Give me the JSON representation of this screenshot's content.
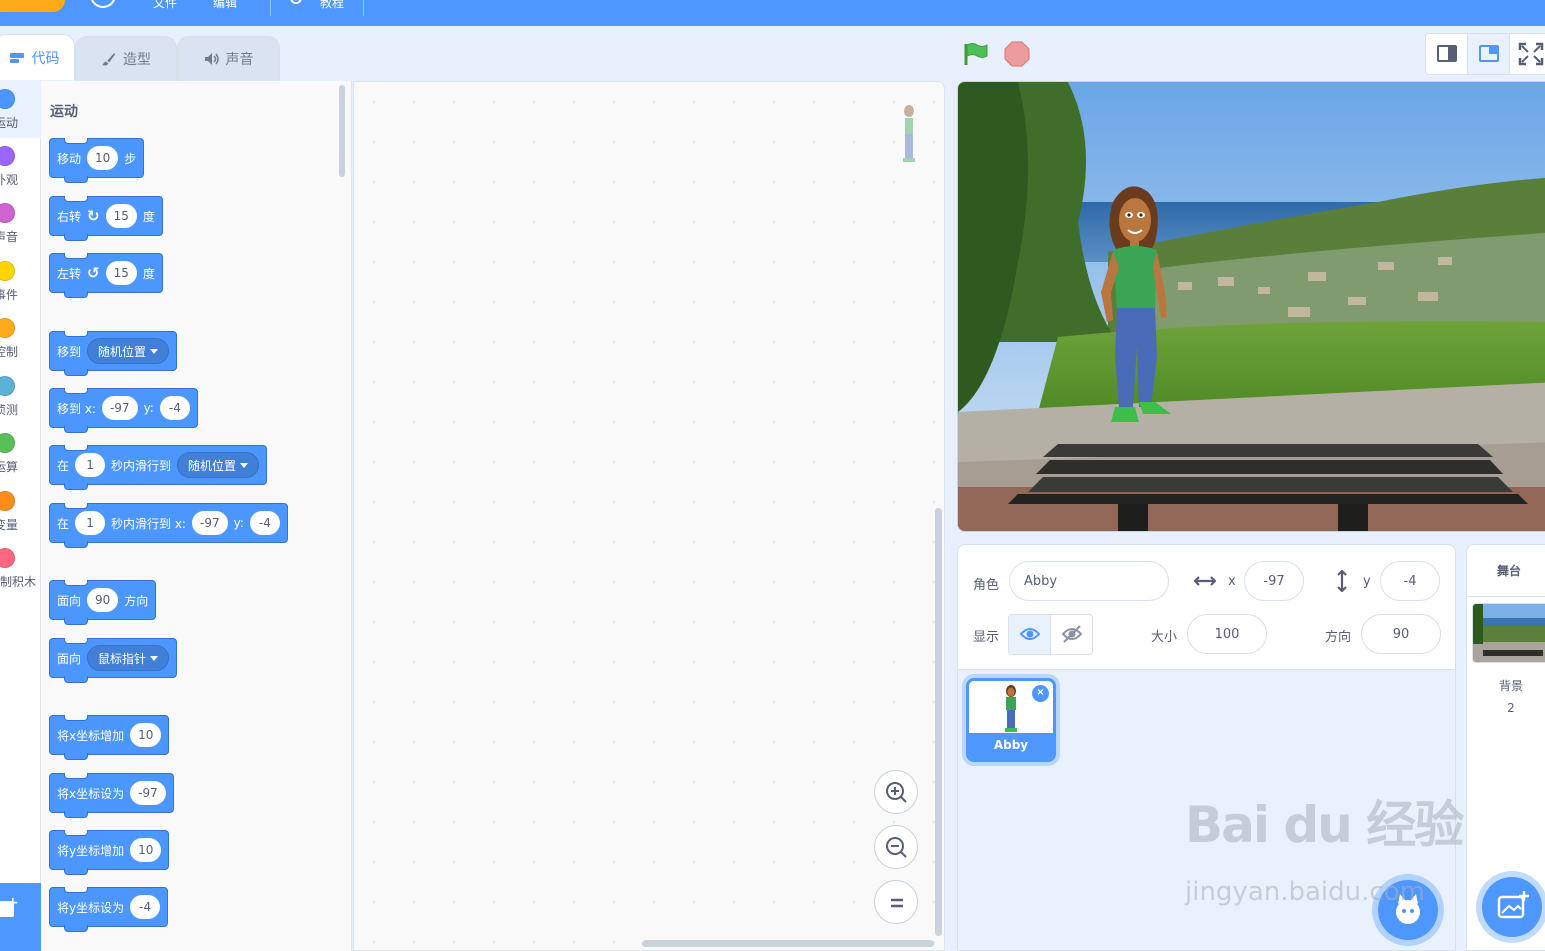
{
  "menubar": {
    "items": [
      "文件",
      "编辑",
      "教程"
    ],
    "accent": "#4d97ff"
  },
  "tabs": [
    {
      "label": "代码",
      "icon": "code-icon",
      "active": true
    },
    {
      "label": "造型",
      "icon": "brush-icon",
      "active": false
    },
    {
      "label": "声音",
      "icon": "speaker-icon",
      "active": false
    }
  ],
  "categories": [
    {
      "label": "运动",
      "color": "#4c97ff",
      "selected": true
    },
    {
      "label": "外观",
      "color": "#9966ff"
    },
    {
      "label": "声音",
      "color": "#cf63cf"
    },
    {
      "label": "事件",
      "color": "#ffd500"
    },
    {
      "label": "控制",
      "color": "#ffab19"
    },
    {
      "label": "侦测",
      "color": "#5cb1d6"
    },
    {
      "label": "运算",
      "color": "#59c059"
    },
    {
      "label": "变量",
      "color": "#ff8c1a"
    },
    {
      "label": "自制积木",
      "color": "#ff6680"
    }
  ],
  "palette": {
    "title": "运动",
    "blocks": {
      "move": {
        "t1": "移动",
        "v1": "10",
        "t2": "步"
      },
      "turn_right": {
        "t1": "右转",
        "icon": "rotate-clockwise-icon",
        "v1": "15",
        "t2": "度"
      },
      "turn_left": {
        "t1": "左转",
        "icon": "rotate-counterclockwise-icon",
        "v1": "15",
        "t2": "度"
      },
      "goto": {
        "t1": "移到",
        "dd": "随机位置"
      },
      "goto_xy": {
        "t1": "移到 x:",
        "x": "-97",
        "t2": "y:",
        "y": "-4"
      },
      "glide_to": {
        "t1": "在",
        "v1": "1",
        "t2": "秒内滑行到",
        "dd": "随机位置"
      },
      "glide_xy": {
        "t1": "在",
        "v1": "1",
        "t2": "秒内滑行到 x:",
        "x": "-97",
        "t3": "y:",
        "y": "-4"
      },
      "point_dir": {
        "t1": "面向",
        "v1": "90",
        "t2": "方向"
      },
      "point_towards": {
        "t1": "面向",
        "dd": "鼠标指针"
      },
      "change_x": {
        "t1": "将x坐标增加",
        "v1": "10"
      },
      "set_x": {
        "t1": "将x坐标设为",
        "v1": "-97"
      },
      "change_y": {
        "t1": "将y坐标增加",
        "v1": "10"
      },
      "set_y": {
        "t1": "将y坐标设为",
        "v1": "-4"
      }
    }
  },
  "sprite_info": {
    "sprite_label": "角色",
    "sprite_name": "Abby",
    "x_label": "x",
    "x_value": "-97",
    "y_label": "y",
    "y_value": "-4",
    "show_label": "显示",
    "size_label": "大小",
    "size_value": "100",
    "direction_label": "方向",
    "direction_value": "90"
  },
  "sprites": [
    {
      "name": "Abby",
      "selected": true
    }
  ],
  "stage_panel": {
    "header": "舞台",
    "backdrop_label": "背景",
    "backdrop_count": "2"
  },
  "watermark": {
    "main": "Bai du 经验",
    "sub": "jingyan.baidu.com"
  }
}
